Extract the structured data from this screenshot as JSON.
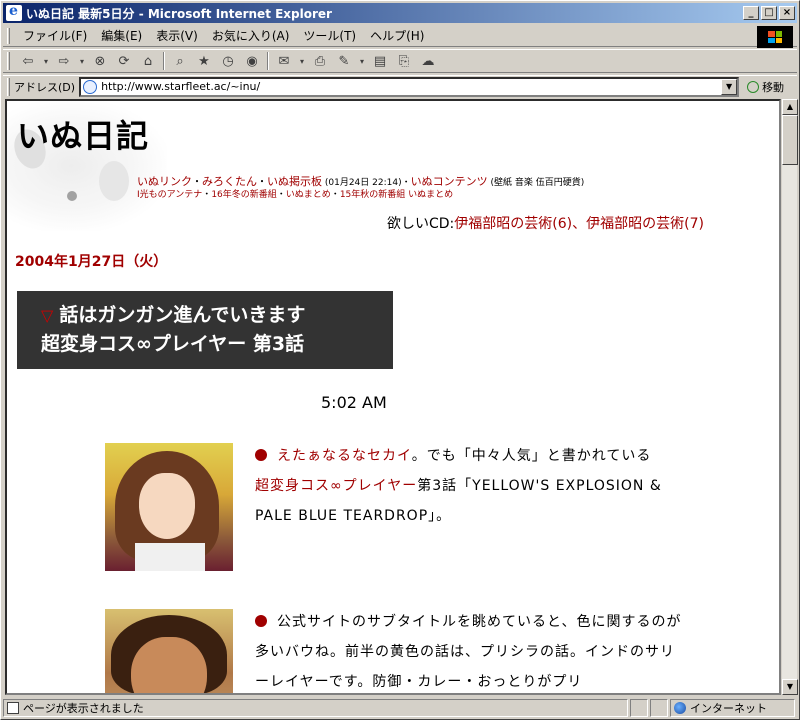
{
  "window": {
    "title": "いぬ日記 最新5日分 - Microsoft Internet Explorer",
    "btn_min": "_",
    "btn_max": "□",
    "btn_close": "×"
  },
  "menu": [
    "ファイル(F)",
    "編集(E)",
    "表示(V)",
    "お気に入り(A)",
    "ツール(T)",
    "ヘルプ(H)"
  ],
  "toolbar": {
    "icons": [
      "back-icon",
      "forward-icon",
      "stop-icon",
      "refresh-icon",
      "home-icon",
      "search-icon",
      "favorites-icon",
      "history-icon",
      "media-icon",
      "mail-icon",
      "print-icon",
      "edit-icon",
      "discuss-icon",
      "messenger-icon"
    ]
  },
  "address": {
    "label": "アドレス(D)",
    "url": "http://www.starfleet.ac/~inu/",
    "go_label": "移動"
  },
  "status": {
    "text": "ページが表示されました",
    "zone": "インターネット"
  },
  "page": {
    "site_title": "いぬ日記",
    "nav1": {
      "link1": "いぬリンク",
      "sep1": "・",
      "link2": "みろくたん",
      "sep2": "・",
      "link3": "いぬ掲示板",
      "bbs_time": " (01月24日 22:14)・",
      "link4": "いぬコンテンツ",
      "extra": " (壁紙 音楽 伍百円硬貨)"
    },
    "nav2": {
      "link1": "I光ものアンテナ",
      "sep1": "・",
      "link2": "16年冬の新番組",
      "sep2": "・",
      "link3": "いぬまとめ",
      "sep3": "・",
      "link4": "15年秋の新番組",
      "sep4": " ",
      "link5": "いぬまとめ"
    },
    "wish": {
      "label": "欲しいCD:",
      "item1": "伊福部昭の芸術(6)",
      "sep": "、",
      "item2": "伊福部昭の芸術(7)"
    },
    "date": "2004年1月27日（火）",
    "headline": {
      "marker": "▽",
      "line1": "話はガンガン進んでいきます",
      "line2": "超変身コス∞プレイヤー 第3話"
    },
    "time": "5:02 AM",
    "entry1": {
      "link1": "えたぁなるなセカイ",
      "t1": "。でも「中々人気」と書かれている",
      "link2": "超変身コス∞プレイヤー",
      "t2": "第3話「YELLOW'S EXPLOSION & PALE BLUE TEARDROP」。"
    },
    "entry2": {
      "text": "公式サイトのサブタイトルを眺めていると、色に関するのが多いバウね。前半の黄色の話は、プリシラの話。インドのサリーレイヤーです。防御・カレー・おっとりがプリ"
    }
  }
}
